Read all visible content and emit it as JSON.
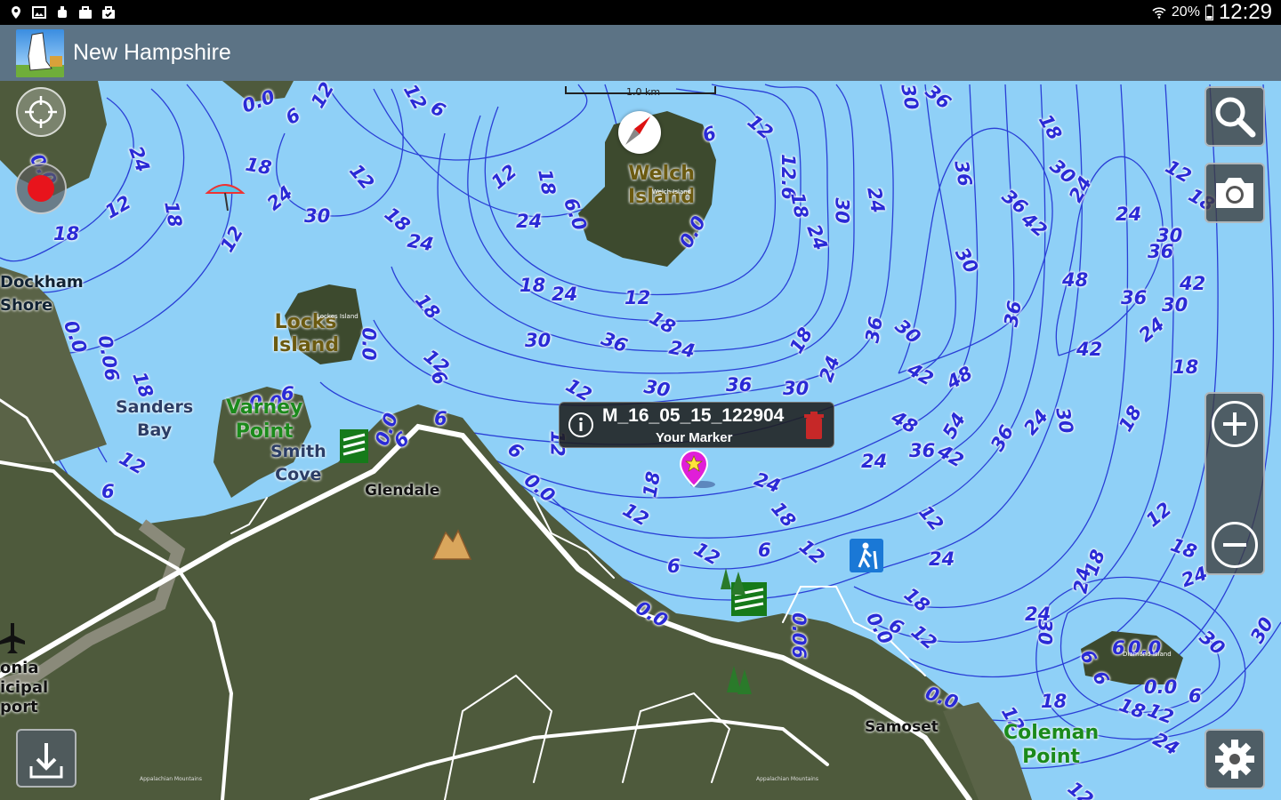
{
  "status_bar": {
    "battery": "20%",
    "time": "12:29",
    "left_icons": [
      "location-icon",
      "image-icon",
      "android-debug-icon",
      "briefcase-icon",
      "briefcase-check-icon"
    ],
    "right_icons": [
      "wifi-icon",
      "battery-icon"
    ]
  },
  "app_bar": {
    "title": "New Hampshire",
    "logo_icon": "new-hampshire-logo-icon"
  },
  "map": {
    "scale_label": "1.0 km",
    "marker_popup": {
      "title": "M_16_05_15_122904",
      "subtitle": "Your Marker"
    },
    "places": {
      "dockham_shore": "Dockham\nShore",
      "sanders_bay": "Sanders\nBay",
      "smith_cove": "Smith\nCove",
      "glendale": "Glendale",
      "samoset": "Samoset",
      "gilford_airport_partial": "onia\nicipal\nport",
      "welch_island": "Welch\nIsland",
      "welch_island_small": "Welch Island",
      "locks_island": "Locks\nIsland",
      "locks_island_small": "Lockes Island",
      "varney_point": "Varney\nPoint",
      "coleman_point": "Coleman\nPoint",
      "diamond_island_small": "Diamond Island",
      "appalachian_1": "Appalachian Mountains",
      "appalachian_2": "Appalachian Mountains"
    },
    "depths": [
      "0.0",
      "6",
      "12",
      "18",
      "24",
      "30",
      "36",
      "42",
      "48",
      "54",
      "6.0",
      "12.6",
      "0.06"
    ],
    "colors": {
      "water": "#8fd0f7",
      "contour": "#2a3fd6",
      "depth_label": "#2a2ad6",
      "land": "#4e5a3c",
      "road": "#ffffff",
      "marker": "#e01ed8"
    }
  },
  "controls": {
    "locate": "crosshair-icon",
    "record": "record-icon",
    "search": "search-icon",
    "camera": "camera-icon",
    "zoom_in": "zoom-in-icon",
    "zoom_out": "zoom-out-icon",
    "download": "download-icon",
    "settings": "gear-icon",
    "compass": "compass-icon"
  }
}
